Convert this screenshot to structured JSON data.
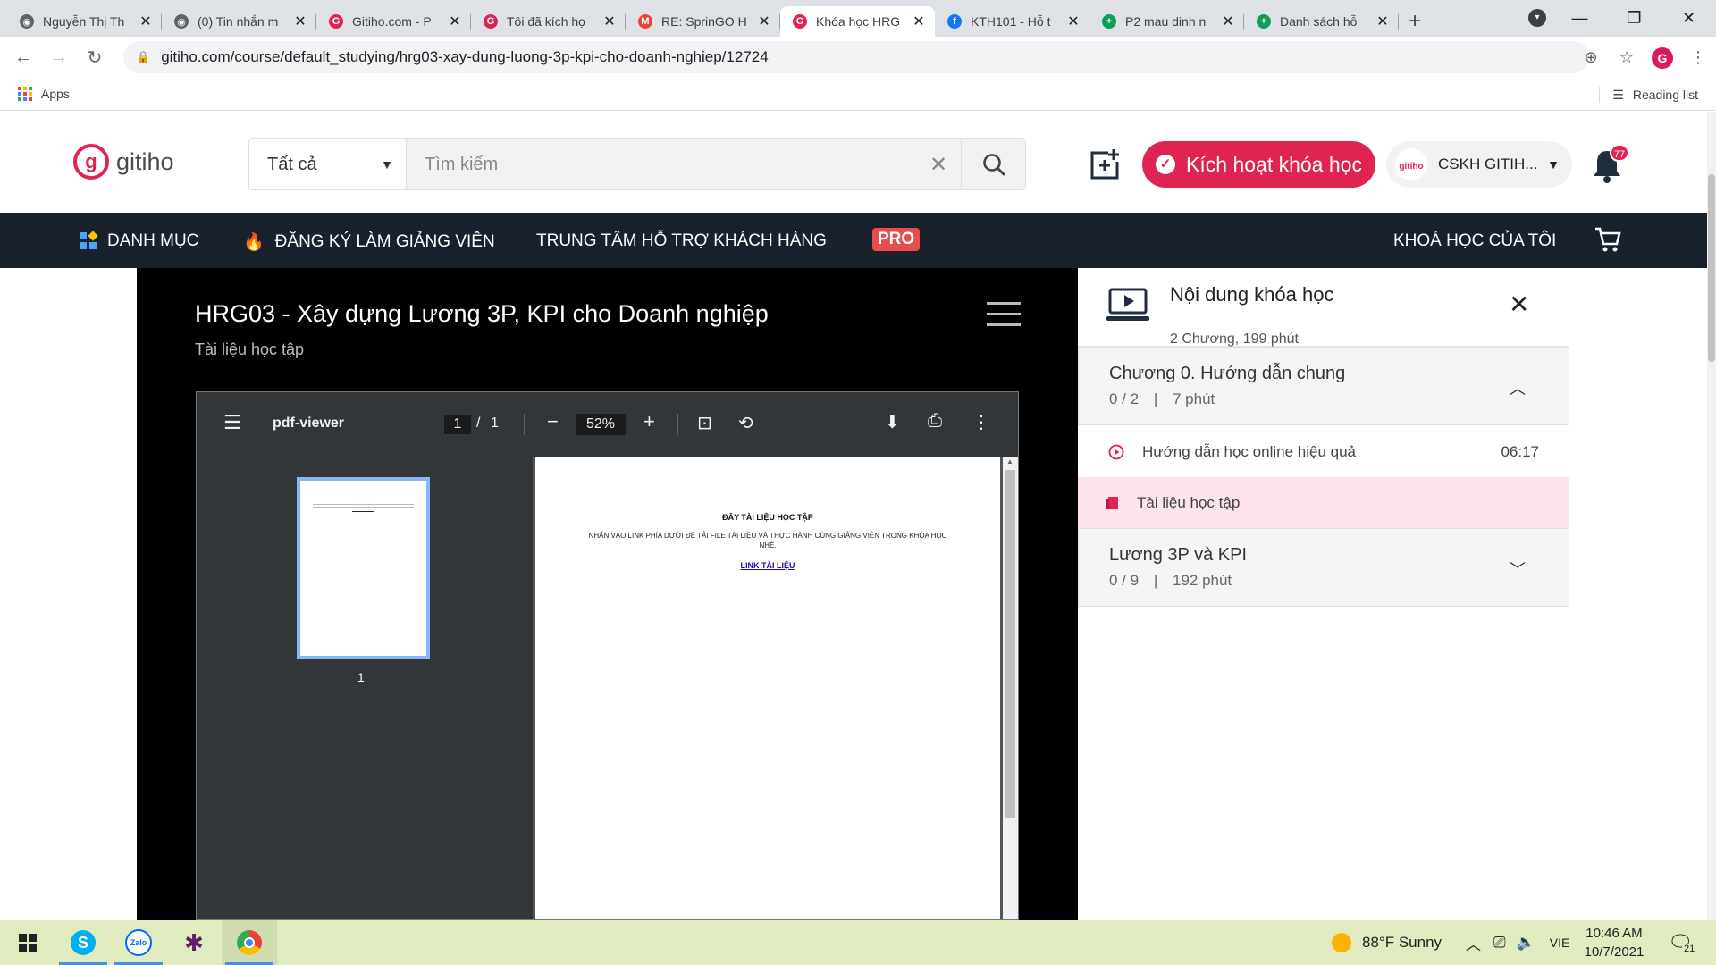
{
  "browser": {
    "tabs": [
      {
        "title": "Nguyễn Thị Th",
        "fav_color": "#5f6368",
        "fav_char": "◉"
      },
      {
        "title": "(0) Tin nhắn m",
        "fav_color": "#5f6368",
        "fav_char": "◉"
      },
      {
        "title": "Gitiho.com - P",
        "fav_color": "#e02451",
        "fav_char": "G"
      },
      {
        "title": "Tôi đã kích họ",
        "fav_color": "#e02451",
        "fav_char": "G"
      },
      {
        "title": "RE: SprinGO H",
        "fav_color": "#ea4335",
        "fav_char": "M"
      },
      {
        "title": "Khóa học HRG",
        "fav_color": "#e02451",
        "fav_char": "G",
        "active": true
      },
      {
        "title": "KTH101 - Hỗ t",
        "fav_color": "#1877f2",
        "fav_char": "f"
      },
      {
        "title": "P2 mau dinh n",
        "fav_color": "#0f9d58",
        "fav_char": "+"
      },
      {
        "title": "Danh sách hỗ",
        "fav_color": "#0f9d58",
        "fav_char": "+"
      }
    ],
    "url": "gitiho.com/course/default_studying/hrg03-xay-dung-luong-3p-kpi-cho-doanh-nghiep/12724",
    "bookmarks_apps": "Apps",
    "reading_list": "Reading list"
  },
  "header": {
    "logo_text": "gitiho",
    "search_category": "Tất cả",
    "search_placeholder": "Tìm kiếm",
    "activate_label": "Kích hoạt khóa học",
    "account_name": "CSKH GITIH...",
    "account_avatar_text": "gitiho",
    "notification_count": "77"
  },
  "nav": {
    "items": [
      "DANH MỤC",
      "ĐĂNG KÝ LÀM GIẢNG VIÊN",
      "TRUNG TÂM HỖ TRỢ KHÁCH HÀNG"
    ],
    "pro_label": "PRO",
    "my_courses": "KHOÁ HỌC CỦA TÔI"
  },
  "player": {
    "course_title": "HRG03 - Xây dựng Lương 3P, KPI cho Doanh nghiệp",
    "subtitle": "Tài liệu học tập"
  },
  "pdf_viewer": {
    "title": "pdf-viewer",
    "current_page": "1",
    "page_sep": "/",
    "total_pages": "1",
    "zoom": "52%",
    "thumb_label": "1",
    "doc_heading": "ĐÂY TÀI LIỆU HỌC TẬP",
    "doc_text": "NHẤN VÀO LINK PHÍA DƯỚI ĐỂ TẢI FILE TÀI LIỆU VÀ THỰC HÀNH CÙNG GIẢNG VIÊN TRONG KHÓA HỌC NHÉ.",
    "doc_link": "LINK TÀI LIỆU"
  },
  "side_panel": {
    "title": "Nội dung khóa học",
    "meta": "2 Chương, 199 phút",
    "chapters": [
      {
        "title": "Chương 0. Hướng dẫn chung",
        "progress": "0 / 2",
        "sep": "|",
        "duration": "7 phút",
        "lessons": [
          {
            "title": "Hướng dẫn học online hiệu quả",
            "duration": "06:17"
          },
          {
            "title": "Tài liệu học tập",
            "duration": ""
          }
        ]
      },
      {
        "title": "Lương 3P và KPI",
        "progress": "0 / 9",
        "sep": "|",
        "duration": "192 phút"
      }
    ]
  },
  "taskbar": {
    "weather": "88°F  Sunny",
    "lang": "VIE",
    "time": "10:46 AM",
    "date": "10/7/2021",
    "notif_count": "21"
  },
  "colors": {
    "brand": "#e02451",
    "nav_bg": "#19222c",
    "active_lesson_bg": "#fde4ea"
  }
}
